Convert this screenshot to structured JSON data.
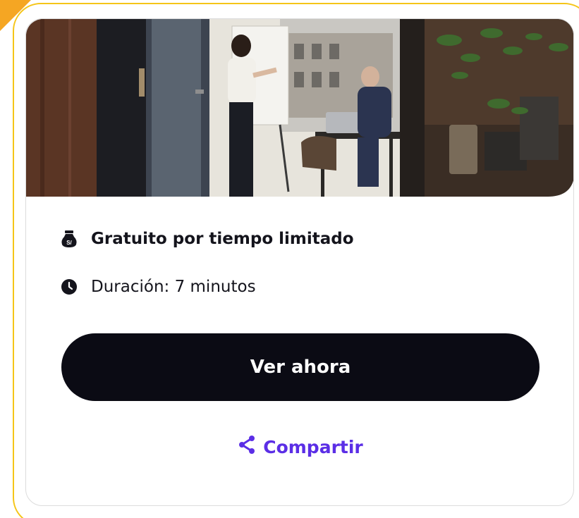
{
  "card": {
    "image_alt": "Oficina con una mujer presentando en una pizarra y un hombre sentado con una laptop",
    "price": {
      "icon": "money-bag-icon",
      "label": "Gratuito por tiempo limitado"
    },
    "duration": {
      "icon": "clock-icon",
      "label": "Duración: 7 minutos"
    },
    "cta_label": "Ver ahora",
    "share": {
      "icon": "share-icon",
      "label": "Compartir"
    }
  },
  "colors": {
    "frame_border": "#f5c518",
    "badge": "#f5a623",
    "cta_background": "#0b0b14",
    "share_accent": "#5b2ee6",
    "text": "#14141c"
  }
}
